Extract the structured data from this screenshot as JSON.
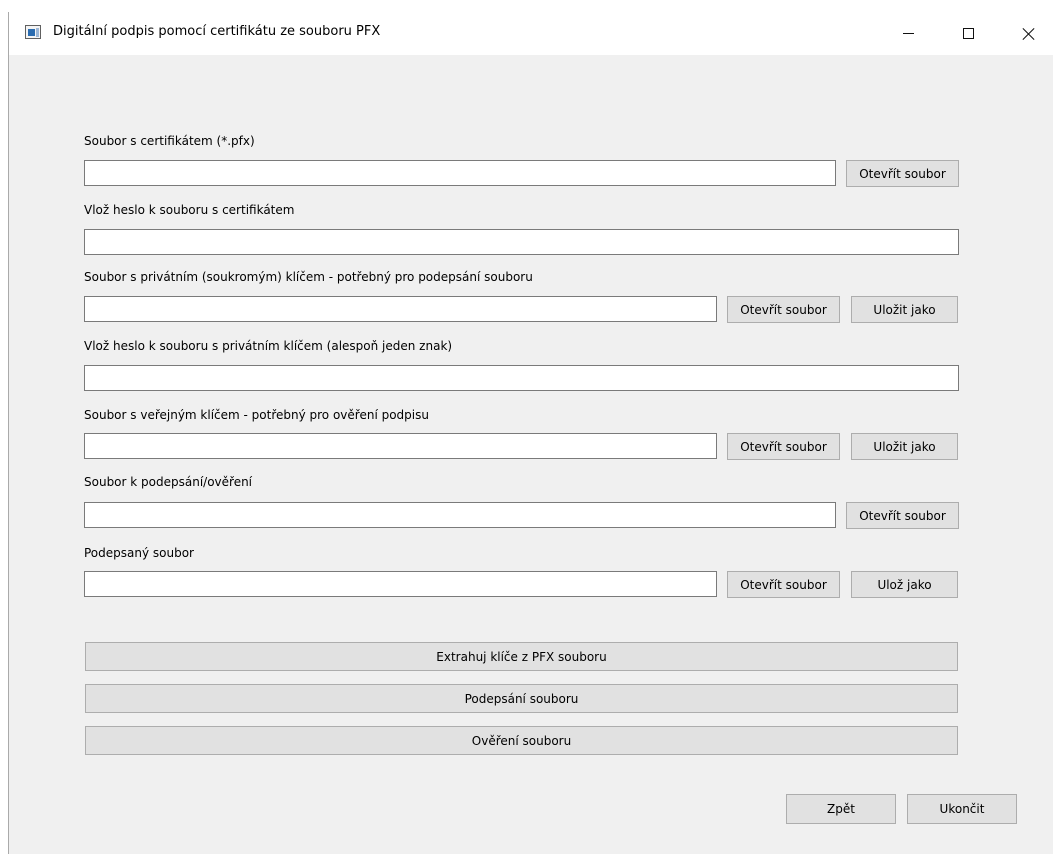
{
  "window": {
    "title": "Digitální podpis pomocí certifikátu ze souboru PFX"
  },
  "form": {
    "cert_file_label": "Soubor s certifikátem (*.pfx)",
    "cert_password_label": "Vlož heslo k souboru s certifikátem",
    "private_key_label": "Soubor s privátním (soukromým) klíčem - potřebný pro podepsání souboru",
    "private_key_password_label": "Vlož heslo k souboru s privátním klíčem (alespoň jeden znak)",
    "public_key_label": "Soubor s veřejným klíčem - potřebný pro ověření podpisu",
    "file_to_sign_label": "Soubor k podepsání/ověření",
    "signed_file_label": "Podepsaný soubor"
  },
  "buttons": {
    "open_file": "Otevřít soubor",
    "save_as": "Uložit jako",
    "save_as_short": "Ulož jako",
    "extract_keys": "Extrahuj klíče z PFX souboru",
    "sign_file": "Podepsání souboru",
    "verify_file": "Ověření souboru",
    "back": "Zpět",
    "quit": "Ukončit"
  }
}
